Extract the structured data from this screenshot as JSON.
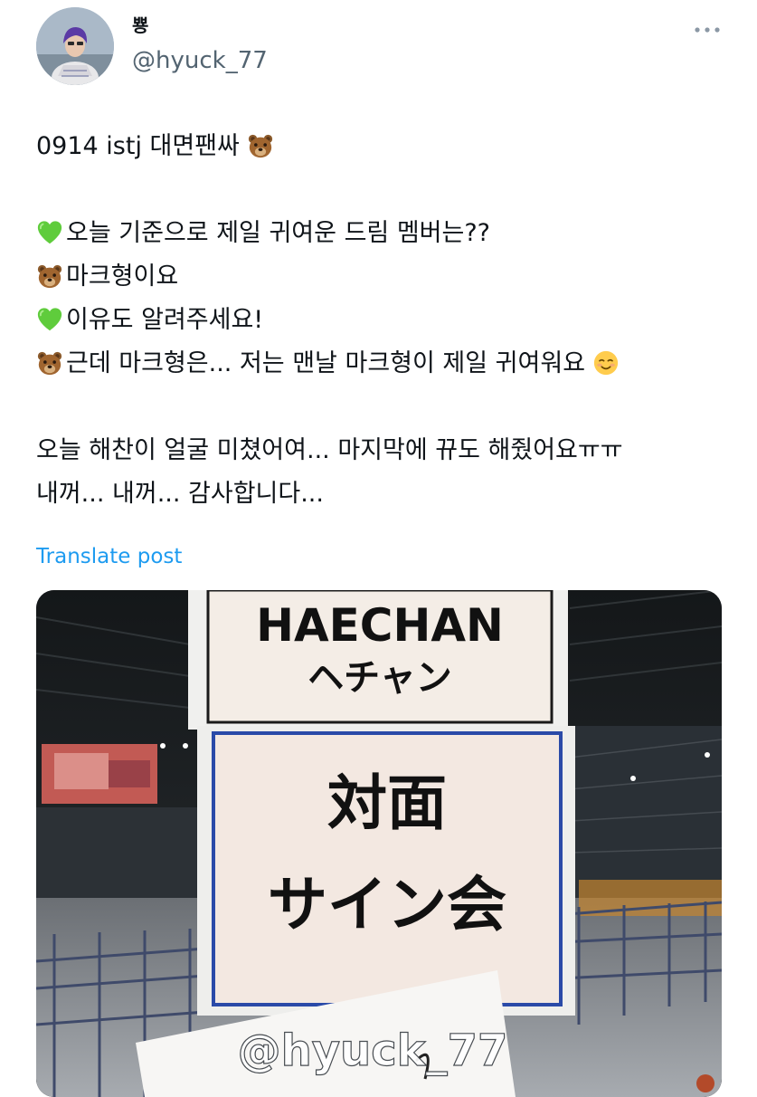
{
  "author": {
    "display_name": "뿅",
    "handle": "@hyuck_77",
    "avatar_icon": "profile-photo"
  },
  "more_icon": "more-horizontal-icon",
  "post": {
    "lines": [
      {
        "text": "0914 istj 대면팬싸",
        "emoji_after": "bear-emoji"
      },
      {
        "blank": true
      },
      {
        "emoji_before": "green-heart-emoji",
        "text": "오늘 기준으로 제일 귀여운 드림 멤버는??"
      },
      {
        "emoji_before": "bear-emoji",
        "text": "마크형이요"
      },
      {
        "emoji_before": "green-heart-emoji",
        "text": "이유도 알려주세요!"
      },
      {
        "emoji_before": "bear-emoji",
        "text": "근데 마크형은... 저는 맨날 마크형이 제일 귀여워요",
        "emoji_after": "smiling-face-emoji"
      },
      {
        "blank": true
      },
      {
        "text": "오늘 해찬이 얼굴 미쳤어여... 마지막에 뀨도 해줬어요ㅠㅠ"
      },
      {
        "text": "내꺼... 내꺼... 감사합니다..."
      }
    ]
  },
  "translate_label": "Translate post",
  "media": {
    "sign_top_line1": "HAECHAN",
    "sign_top_line2": "ヘチャン",
    "sign_main_line1": "対面",
    "sign_main_line2": "サイン会",
    "watermark": "@hyuck_77"
  },
  "colors": {
    "text": "#0f1419",
    "secondary": "#536471",
    "link": "#1d9bf0"
  }
}
